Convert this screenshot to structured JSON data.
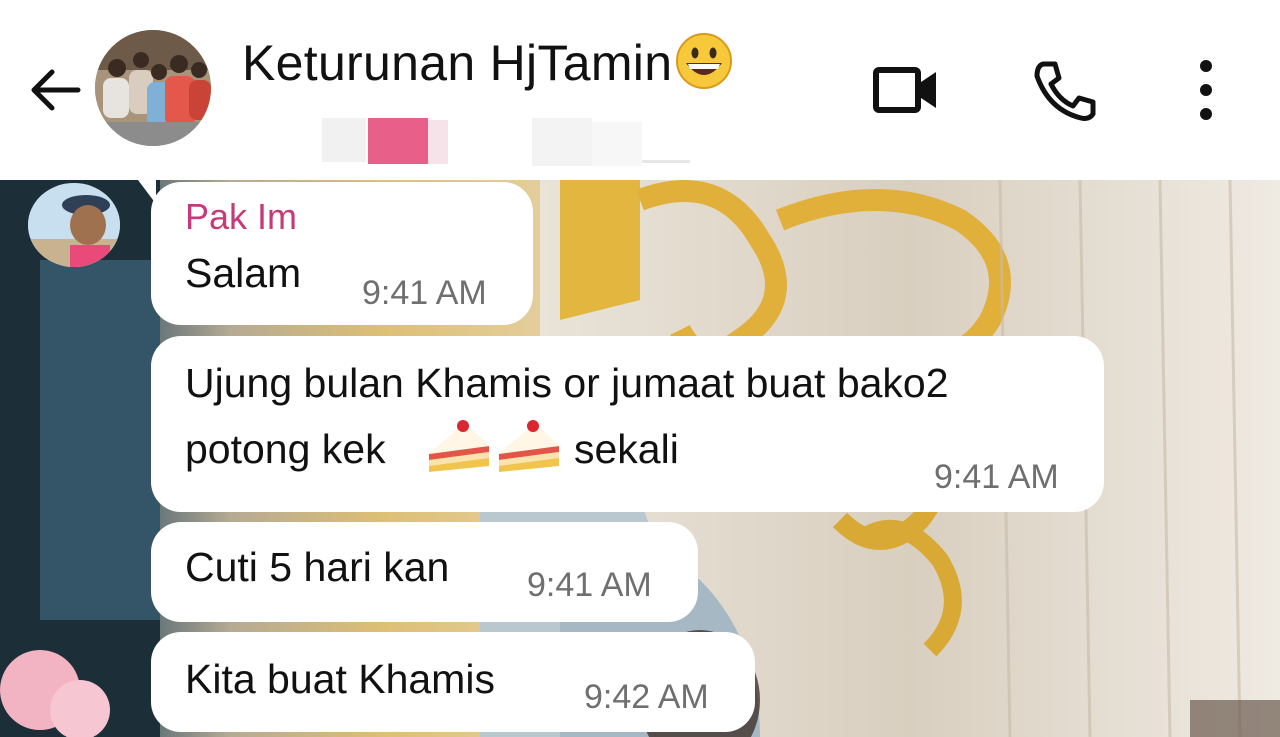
{
  "header": {
    "title": "Keturunan HjTamin",
    "title_emoji": "grinning-face-emoji",
    "icons": [
      "back-arrow-icon",
      "video-call-icon",
      "voice-call-icon",
      "more-options-icon"
    ]
  },
  "messages": [
    {
      "sender": "Pak Im",
      "text": "Salam",
      "time": "9:41 AM"
    },
    {
      "text_line1": "Ujung bulan Khamis or jumaat buat bako2",
      "text_line2a": "potong kek",
      "text_line2b": "sekali",
      "emoji": "shortcake-emoji",
      "time": "9:41 AM"
    },
    {
      "text": "Cuti 5 hari kan",
      "time": "9:41 AM"
    },
    {
      "text": "Kita buat Khamis",
      "time": "9:42 AM"
    }
  ],
  "colors": {
    "sender_name": "#c53b7a",
    "time": "#6f6f6f",
    "bubble": "#ffffff"
  }
}
